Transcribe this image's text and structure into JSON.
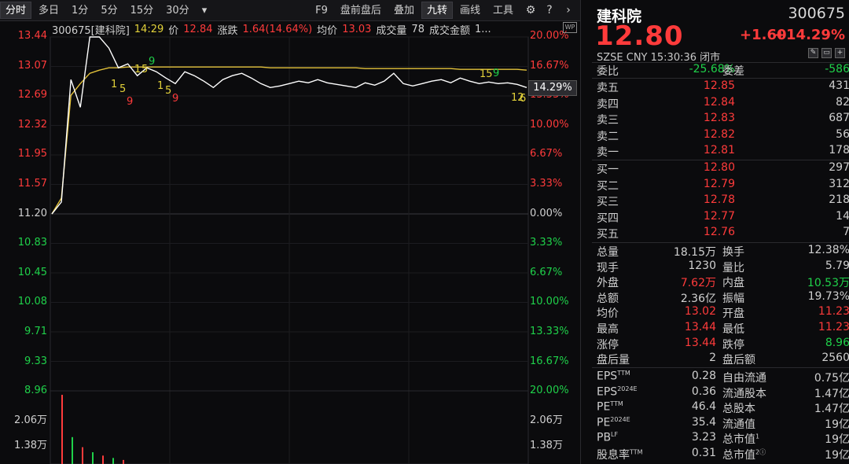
{
  "toolbar": {
    "tabs": [
      "分时",
      "多日",
      "1分",
      "5分",
      "15分",
      "30分"
    ],
    "active_tab": "分时",
    "dropdown_glyph": "▾",
    "right_items": [
      "F9",
      "盘前盘后",
      "叠加",
      "九转",
      "画线",
      "工具"
    ],
    "active_right": "九转"
  },
  "chart": {
    "infobar": {
      "code_name": "300675[建科院]",
      "time": "14:29",
      "price_label": "价",
      "price": "12.84",
      "chg_label": "涨跌",
      "chg": "1.64(14.64%)",
      "avg_label": "均价",
      "avg": "13.03",
      "vol_label": "成交量",
      "vol": "78",
      "amt_label": "成交金额",
      "amt": "1..."
    },
    "wp_tag": "WP",
    "current_tag": "14.29%",
    "left_axis": [
      {
        "v": "13.44",
        "c": "red"
      },
      {
        "v": "13.07",
        "c": "red"
      },
      {
        "v": "12.69",
        "c": "red"
      },
      {
        "v": "12.32",
        "c": "red"
      },
      {
        "v": "11.95",
        "c": "red"
      },
      {
        "v": "11.57",
        "c": "red"
      },
      {
        "v": "11.20",
        "c": "white"
      },
      {
        "v": "10.83",
        "c": "green"
      },
      {
        "v": "10.45",
        "c": "green"
      },
      {
        "v": "10.08",
        "c": "green"
      },
      {
        "v": "9.71",
        "c": "green"
      },
      {
        "v": "9.33",
        "c": "green"
      },
      {
        "v": "8.96",
        "c": "green"
      }
    ],
    "right_axis": [
      {
        "v": "20.00%",
        "c": "red"
      },
      {
        "v": "16.67%",
        "c": "red"
      },
      {
        "v": "13.33%",
        "c": "red"
      },
      {
        "v": "10.00%",
        "c": "red"
      },
      {
        "v": "6.67%",
        "c": "red"
      },
      {
        "v": "3.33%",
        "c": "red"
      },
      {
        "v": "0.00%",
        "c": "white"
      },
      {
        "v": "3.33%",
        "c": "green"
      },
      {
        "v": "6.67%",
        "c": "green"
      },
      {
        "v": "10.00%",
        "c": "green"
      },
      {
        "v": "13.33%",
        "c": "green"
      },
      {
        "v": "16.67%",
        "c": "green"
      },
      {
        "v": "20.00%",
        "c": "green"
      }
    ],
    "vol_axis_left": [
      "2.06万",
      "1.38万"
    ],
    "vol_axis_right": [
      "2.06万",
      "1.38万"
    ],
    "nine_turn_marks": [
      "1",
      "5",
      "9",
      "1",
      "5",
      "9",
      "1",
      "5",
      "9",
      "1",
      "5",
      "9",
      "15",
      "9",
      "12",
      "6"
    ],
    "colors": {
      "price_line": "#ffffff",
      "avg_line": "#e3c23a",
      "up": "#ff3b3b",
      "down": "#1fd14a"
    }
  },
  "chart_data": {
    "type": "line",
    "title": "",
    "y_price_range": [
      8.96,
      13.44
    ],
    "y_pct_range": [
      -20.0,
      20.0
    ],
    "prev_close": 11.2,
    "series": [
      {
        "name": "价",
        "values": [
          11.2,
          11.35,
          12.9,
          12.55,
          13.44,
          13.44,
          13.3,
          13.05,
          13.1,
          12.95,
          13.05,
          13.0,
          12.92,
          12.85,
          13.0,
          12.95,
          12.88,
          12.8,
          12.9,
          12.95,
          12.98,
          12.92,
          12.85,
          12.8,
          12.82,
          12.85,
          12.88,
          12.86,
          12.9,
          12.86,
          12.84,
          12.82,
          12.8,
          12.86,
          12.83,
          12.88,
          12.98,
          12.85,
          12.82,
          12.85,
          12.88,
          12.9,
          12.86,
          12.92,
          12.88,
          12.85,
          12.87,
          12.85,
          12.86,
          12.84,
          12.8
        ]
      },
      {
        "name": "均价",
        "values": [
          11.2,
          11.4,
          12.7,
          12.85,
          12.98,
          13.02,
          13.05,
          13.05,
          13.06,
          13.06,
          13.06,
          13.06,
          13.06,
          13.06,
          13.06,
          13.06,
          13.06,
          13.06,
          13.06,
          13.06,
          13.06,
          13.06,
          13.06,
          13.05,
          13.05,
          13.05,
          13.05,
          13.05,
          13.05,
          13.05,
          13.05,
          13.05,
          13.05,
          13.04,
          13.04,
          13.04,
          13.04,
          13.04,
          13.04,
          13.04,
          13.04,
          13.04,
          13.04,
          13.03,
          13.03,
          13.03,
          13.03,
          13.03,
          13.03,
          13.03,
          13.02
        ]
      },
      {
        "name": "成交量",
        "values": [
          20600,
          8000,
          5000,
          3500,
          2500,
          1800,
          1200
        ]
      }
    ]
  },
  "panel": {
    "name": "建科院",
    "code": "300675",
    "price": "12.80",
    "change": "+1.60",
    "change_pct": "+14.29%",
    "sub": "SZSE  CNY  15:30:36  闭市",
    "weibi": {
      "label": "委比",
      "value": "-25.68%",
      "label2": "委差",
      "value2": "-586"
    },
    "asks": [
      {
        "label": "卖五",
        "price": "12.85",
        "vol": "431"
      },
      {
        "label": "卖四",
        "price": "12.84",
        "vol": "82"
      },
      {
        "label": "卖三",
        "price": "12.83",
        "vol": "687"
      },
      {
        "label": "卖二",
        "price": "12.82",
        "vol": "56"
      },
      {
        "label": "卖一",
        "price": "12.81",
        "vol": "178"
      }
    ],
    "bids": [
      {
        "label": "买一",
        "price": "12.80",
        "vol": "297"
      },
      {
        "label": "买二",
        "price": "12.79",
        "vol": "312"
      },
      {
        "label": "买三",
        "price": "12.78",
        "vol": "218"
      },
      {
        "label": "买四",
        "price": "12.77",
        "vol": "14"
      },
      {
        "label": "买五",
        "price": "12.76",
        "vol": "7"
      }
    ],
    "stats": [
      {
        "l1": "总量",
        "v1": "18.15万",
        "c1": "white",
        "l2": "换手",
        "v2": "12.38%",
        "c2": "white"
      },
      {
        "l1": "现手",
        "v1": "1230",
        "c1": "white",
        "l2": "量比",
        "v2": "5.79",
        "c2": "white"
      },
      {
        "l1": "外盘",
        "v1": "7.62万",
        "c1": "red",
        "l2": "内盘",
        "v2": "10.53万",
        "c2": "green"
      },
      {
        "l1": "总额",
        "v1": "2.36亿",
        "c1": "white",
        "l2": "振幅",
        "v2": "19.73%",
        "c2": "white"
      },
      {
        "l1": "均价",
        "v1": "13.02",
        "c1": "red",
        "l2": "开盘",
        "v2": "11.23",
        "c2": "red"
      },
      {
        "l1": "最高",
        "v1": "13.44",
        "c1": "red",
        "l2": "最低",
        "v2": "11.23",
        "c2": "red"
      },
      {
        "l1": "涨停",
        "v1": "13.44",
        "c1": "red",
        "l2": "跌停",
        "v2": "8.96",
        "c2": "green"
      },
      {
        "l1": "盘后量",
        "v1": "2",
        "c1": "white",
        "l2": "盘后额",
        "v2": "2560",
        "c2": "white"
      }
    ],
    "fundamentals": [
      {
        "l1": "EPS",
        "s1": "TTM",
        "v1": "0.28",
        "l2": "自由流通",
        "s2": "",
        "v2": "0.75亿"
      },
      {
        "l1": "EPS",
        "s1": "2024E",
        "v1": "0.36",
        "l2": "流通股本",
        "s2": "",
        "v2": "1.47亿"
      },
      {
        "l1": "PE",
        "s1": "TTM",
        "v1": "46.4",
        "l2": "总股本",
        "s2": "",
        "v2": "1.47亿"
      },
      {
        "l1": "PE",
        "s1": "2024E",
        "v1": "35.4",
        "l2": "流通值",
        "s2": "",
        "v2": "19亿"
      },
      {
        "l1": "PB",
        "s1": "LF",
        "v1": "3.23",
        "l2": "总市值",
        "s2": "1",
        "v2": "19亿"
      },
      {
        "l1": "股息率",
        "s1": "TTM",
        "v1": "0.31",
        "l2": "总市值",
        "s2": "2ⓘ",
        "v2": "19亿"
      }
    ]
  }
}
